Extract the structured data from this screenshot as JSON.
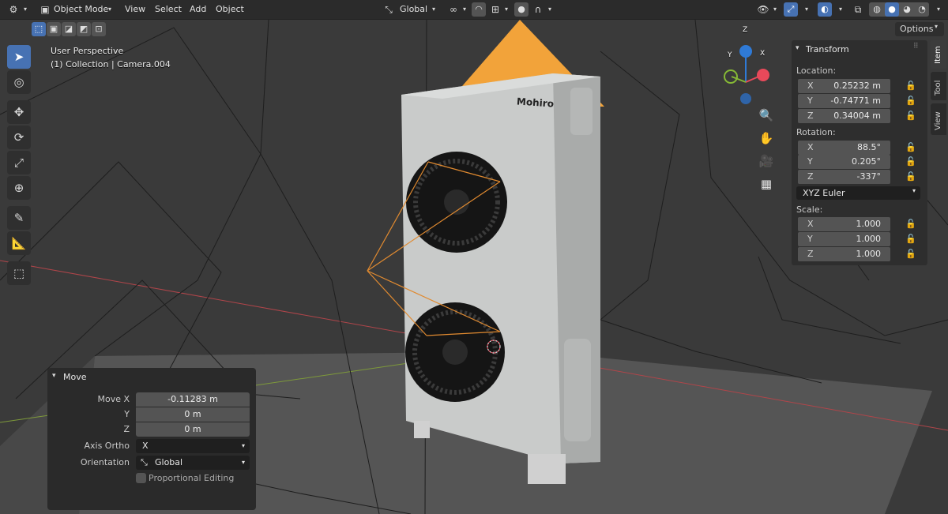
{
  "header": {
    "mode": "Object Mode",
    "menus": [
      "View",
      "Select",
      "Add",
      "Object"
    ],
    "transform_orientation": "Global",
    "options": "Options"
  },
  "viewport": {
    "perspective": "User Perspective",
    "context": "(1) Collection | Camera.004",
    "logo_text": "Mohiro"
  },
  "transform": {
    "title": "Transform",
    "location_label": "Location:",
    "location": [
      {
        "axis": "X",
        "value": "0.25232 m"
      },
      {
        "axis": "Y",
        "value": "-0.74771 m"
      },
      {
        "axis": "Z",
        "value": "0.34004 m"
      }
    ],
    "rotation_label": "Rotation:",
    "rotation": [
      {
        "axis": "X",
        "value": "88.5°"
      },
      {
        "axis": "Y",
        "value": "0.205°"
      },
      {
        "axis": "Z",
        "value": "-337°"
      }
    ],
    "rotation_mode": "XYZ Euler",
    "scale_label": "Scale:",
    "scale": [
      {
        "axis": "X",
        "value": "1.000"
      },
      {
        "axis": "Y",
        "value": "1.000"
      },
      {
        "axis": "Z",
        "value": "1.000"
      }
    ]
  },
  "sidetabs": [
    "Item",
    "Tool",
    "View"
  ],
  "move_panel": {
    "title": "Move",
    "move_x_label": "Move X",
    "move_x": "-0.11283 m",
    "y_label": "Y",
    "y": "0 m",
    "z_label": "Z",
    "z": "0 m",
    "axis_ortho_label": "Axis Ortho",
    "axis_ortho": "X",
    "orientation_label": "Orientation",
    "orientation": "Global",
    "proportional_editing": "Proportional Editing"
  },
  "gizmo": {
    "x": "X",
    "y": "Y",
    "z": "Z"
  },
  "colors": {
    "accent": "#4772b3",
    "camera_orange": "#f2a33a",
    "x_axis": "#e8495a",
    "y_axis": "#86b935",
    "z_axis": "#2f7ad6"
  }
}
